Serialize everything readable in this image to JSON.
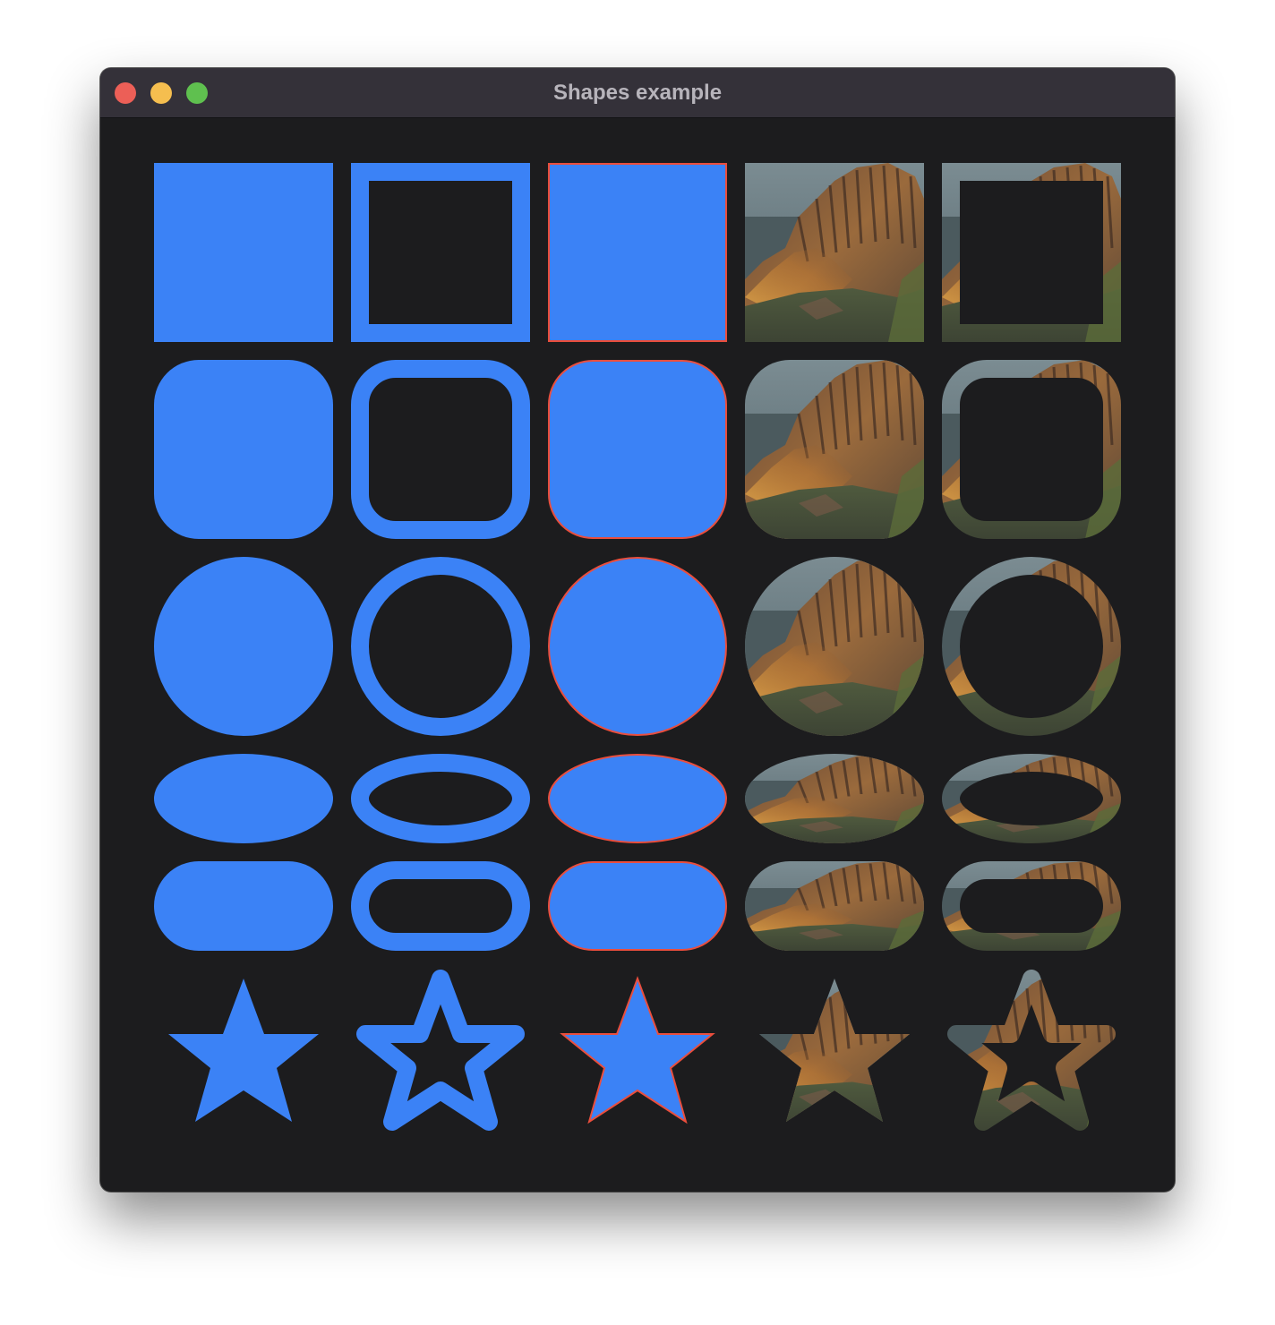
{
  "window": {
    "title": "Shapes example",
    "traffic_lights": [
      {
        "name": "close",
        "color": "#ec5f57"
      },
      {
        "name": "minimize",
        "color": "#f5be4f"
      },
      {
        "name": "maximize",
        "color": "#5fc04f"
      }
    ]
  },
  "colors": {
    "fill": "#3b82f6",
    "outline": "#ea4e3d",
    "background": "#1c1c1e"
  },
  "rows": [
    {
      "shape": "square"
    },
    {
      "shape": "rounded-square"
    },
    {
      "shape": "circle"
    },
    {
      "shape": "ellipse"
    },
    {
      "shape": "capsule"
    },
    {
      "shape": "star"
    }
  ],
  "columns": [
    {
      "style": "fill"
    },
    {
      "style": "stroke"
    },
    {
      "style": "fill-with-outline"
    },
    {
      "style": "image-fill"
    },
    {
      "style": "image-stroke"
    }
  ]
}
